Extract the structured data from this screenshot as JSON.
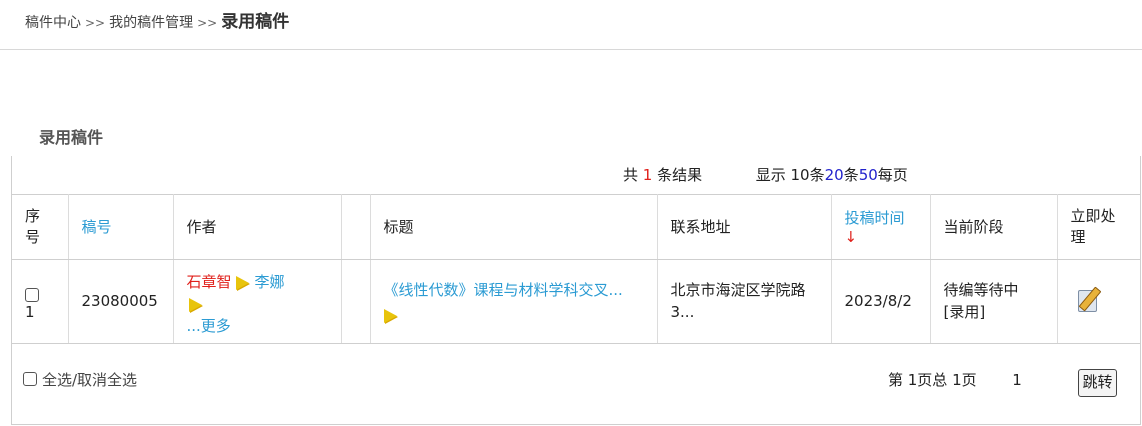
{
  "breadcrumb": {
    "items": [
      "稿件中心",
      "我的稿件管理"
    ],
    "separator": ">>",
    "current": "录用稿件"
  },
  "section_title": "录用稿件",
  "summary": {
    "prefix": "共",
    "count": "1",
    "suffix": "条结果",
    "display_label": "显示",
    "opt10": "10条",
    "opt20": "20",
    "opt20_unit": "条",
    "opt50": "50",
    "per_page": "每页"
  },
  "table": {
    "headers": {
      "seq": "序号",
      "manuscript_no": "稿号",
      "author": "作者",
      "title": "标题",
      "address": "联系地址",
      "submit_time": "投稿时间",
      "sort_arrow": "↓",
      "stage": "当前阶段",
      "action": "立即处理"
    },
    "rows": [
      {
        "seq": "1",
        "manuscript_no": "23080005",
        "author_primary": "石章智",
        "author_secondary": "李娜",
        "author_more": "...更多",
        "title": "《线性代数》课程与材料学科交叉...",
        "address": "北京市海淀区学院路3...",
        "submit_time": "2023/8/2",
        "stage": "待编等待中[录用]"
      }
    ]
  },
  "footer": {
    "select_all_label": "全选/取消全选",
    "page_info": "第 1页总 1页",
    "page_input": "1",
    "jump_label": "跳转"
  },
  "colors": {
    "link": "#2b9bd3",
    "highlight_red": "#e0201b",
    "page_size_blue": "#2222cc"
  }
}
